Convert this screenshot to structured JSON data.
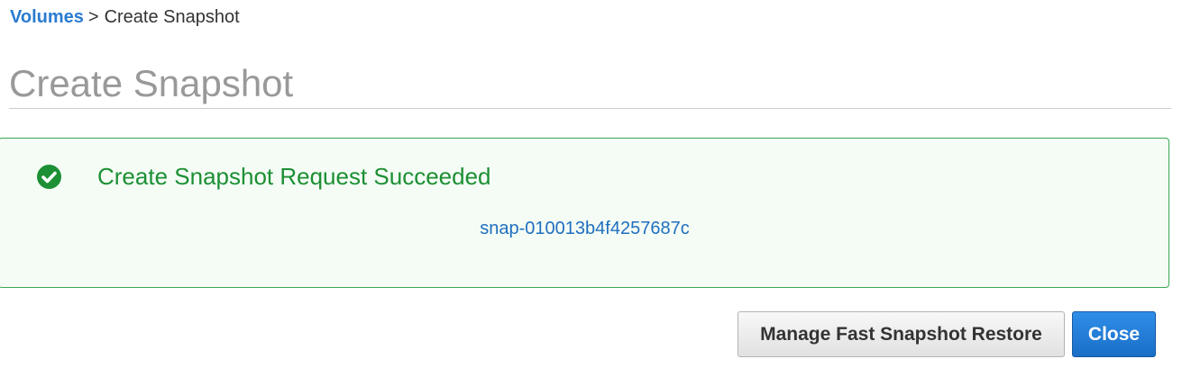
{
  "breadcrumb": {
    "parent_label": "Volumes",
    "separator": ">",
    "current_label": "Create Snapshot"
  },
  "page": {
    "title": "Create Snapshot"
  },
  "notification": {
    "status": "success",
    "icon": "check-circle-icon",
    "heading": "Create Snapshot Request Succeeded",
    "snapshot_id": "snap-010013b4f4257687c",
    "colors": {
      "border": "#39a957",
      "background": "#f4fcf5",
      "heading": "#1d8f34",
      "link": "#1f6fbf"
    }
  },
  "actions": {
    "manage_fsr_label": "Manage Fast Snapshot Restore",
    "close_label": "Close",
    "primary_color": "#1a6ec7"
  }
}
